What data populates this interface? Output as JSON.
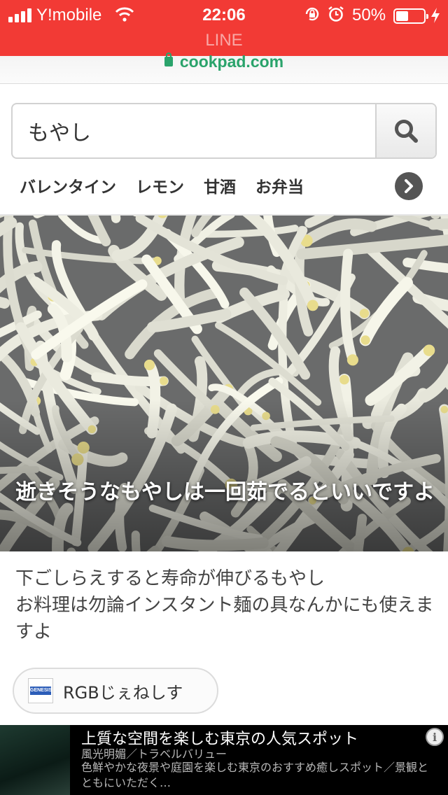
{
  "status_bar": {
    "carrier": "Y!mobile",
    "time": "22:06",
    "battery_percent": "50%",
    "battery_level": 0.5,
    "app_name": "LINE"
  },
  "url_bar": {
    "domain": "cookpad.com"
  },
  "search": {
    "value": "もやし"
  },
  "keywords": [
    "バレンタイン",
    "レモン",
    "甘酒",
    "お弁当"
  ],
  "hero": {
    "title": "逝きそうなもやしは一回茹でるといいですよ"
  },
  "description": {
    "line1": "下ごしらえすると寿命が伸びるもやし",
    "line2": "お料理は勿論インスタント麺の具なんかにも使えますよ"
  },
  "author": {
    "name": "RGBじぇねしす",
    "avatar_text": "GENESIS"
  },
  "ad": {
    "title": "上質な空間を楽しむ東京の人気スポット",
    "subtitle": "風光明媚／トラベルバリュー",
    "body": "色鮮やかな夜景や庭園を楽しむ東京のおすすめ癒しスポット／景観とともにいただく…",
    "info_label": "i"
  },
  "colors": {
    "status_bar_bg": "#f23a35",
    "url_green": "#2aa36b",
    "ad_bg": "#000000"
  },
  "icons": {
    "search": "search-icon",
    "next": "chevron-right-icon",
    "lock": "lock-icon",
    "wifi": "wifi-icon",
    "alarm": "alarm-icon",
    "orientation_lock": "orientation-lock-icon",
    "battery": "battery-icon",
    "charging": "charging-icon",
    "info": "info-icon"
  }
}
